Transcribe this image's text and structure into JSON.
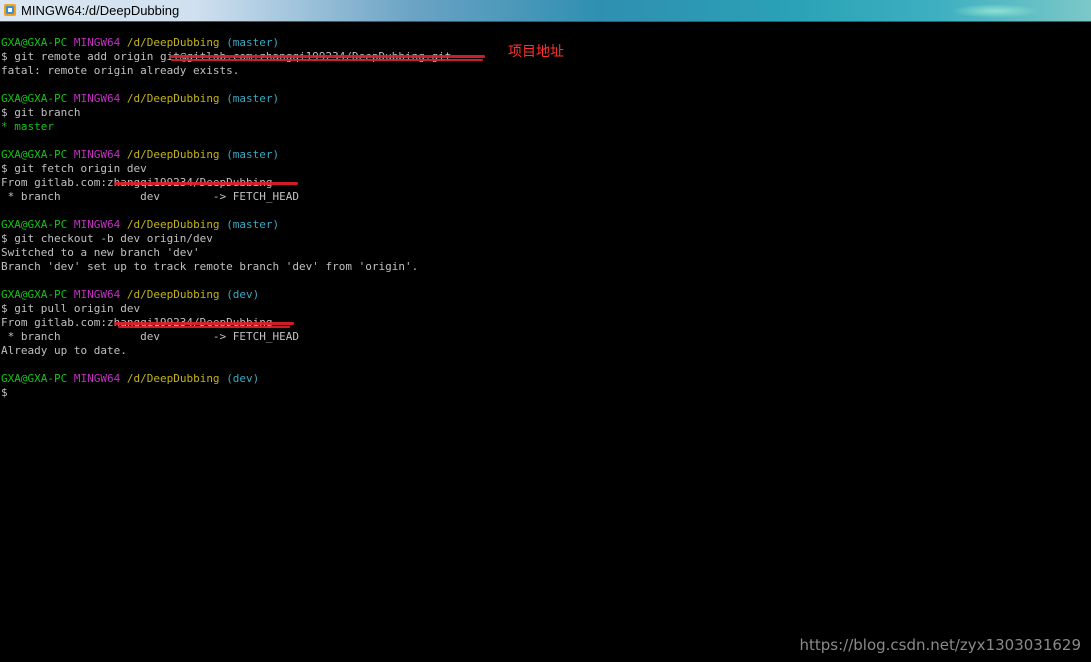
{
  "window": {
    "title": "MINGW64:/d/DeepDubbing"
  },
  "prompt": {
    "user": "GXA@GXA-PC",
    "system": "MINGW64",
    "path": "/d/DeepDubbing",
    "branch_master": "(master)",
    "branch_dev": "(dev)",
    "symbol": "$"
  },
  "commands": {
    "remote_add": "$ git remote add origin ",
    "remote_url": "git@gitlab.com:zhangqi199234/DeepDubbing.git",
    "branch": "$ git branch",
    "fetch": "$ git fetch origin dev",
    "checkout": "$ git checkout -b dev origin/dev",
    "pull": "$ git pull origin dev",
    "empty": "$"
  },
  "output": {
    "fatal": "fatal: remote origin already exists.",
    "current_branch": "* master",
    "from_fetch": "From gitlab.com:zhangqi199234/DeepDubbing",
    "fetch_head": " * branch            dev        -> FETCH_HEAD",
    "switched": "Switched to a new branch 'dev'",
    "track": "Branch 'dev' set up to track remote branch 'dev' from 'origin'.",
    "from_pull": "From gitlab.com:zhangqi199234/DeepDubbing",
    "pull_head": " * branch            dev        -> FETCH_HEAD",
    "up_to_date": "Already up to date."
  },
  "annotation": {
    "label": "项目地址"
  },
  "watermark": {
    "text": "https://blog.csdn.net/zyx1303031629"
  },
  "colors": {
    "user": "#13c313",
    "system": "#c030c0",
    "path": "#c3b413",
    "branch": "#3aa9c6",
    "redaction": "#e0202a"
  }
}
